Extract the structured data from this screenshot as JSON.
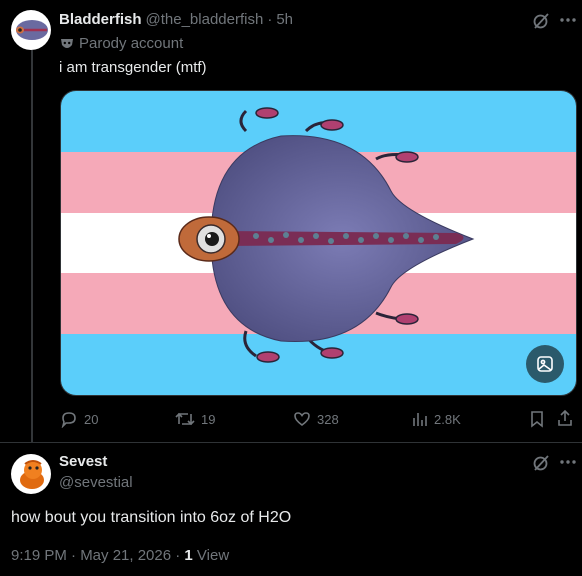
{
  "tweet": {
    "display_name": "Bladderfish",
    "handle": "@the_bladderfish",
    "separator": "·",
    "time": "5h",
    "parody_label": "Parody account",
    "text": "i am transgender (mtf)",
    "actions": {
      "replies": "20",
      "reposts": "19",
      "likes": "328",
      "views": "2.8K"
    }
  },
  "reply": {
    "display_name": "Sevest",
    "handle": "@sevestial",
    "text": "how bout you transition into 6oz of H2O",
    "timestamp": "9:19 PM · May 21, 2026 · ",
    "views_count": "1",
    "views_label": " View"
  },
  "colors": {
    "flag_blue": "#5bcefa",
    "flag_pink": "#f5a9b8",
    "flag_white": "#ffffff",
    "accent": "#1d9bf0"
  },
  "icons": [
    "grok-icon",
    "more-icon",
    "mask-icon",
    "reply-icon",
    "repost-icon",
    "like-icon",
    "views-icon",
    "bookmark-icon",
    "share-icon",
    "alt-icon"
  ]
}
